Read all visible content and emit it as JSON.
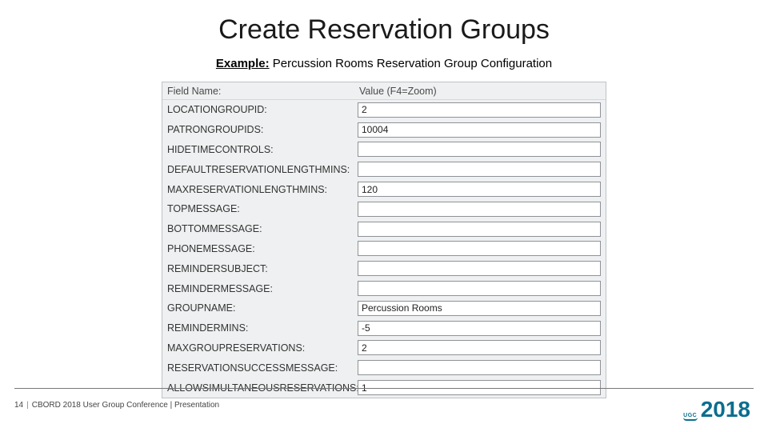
{
  "title": "Create Reservation Groups",
  "subtitle_prefix": "Example:",
  "subtitle_rest": " Percussion Rooms Reservation Group Configuration",
  "form": {
    "header_label": "Field Name:",
    "header_value": "Value (F4=Zoom)",
    "rows": [
      {
        "name": "LOCATIONGROUPID:",
        "value": "2"
      },
      {
        "name": "PATRONGROUPIDS:",
        "value": "10004"
      },
      {
        "name": "HIDETIMECONTROLS:",
        "value": ""
      },
      {
        "name": "DEFAULTRESERVATIONLENGTHMINS:",
        "value": ""
      },
      {
        "name": "MAXRESERVATIONLENGTHMINS:",
        "value": "120"
      },
      {
        "name": "TOPMESSAGE:",
        "value": ""
      },
      {
        "name": "BOTTOMMESSAGE:",
        "value": ""
      },
      {
        "name": "PHONEMESSAGE:",
        "value": ""
      },
      {
        "name": "REMINDERSUBJECT:",
        "value": ""
      },
      {
        "name": "REMINDERMESSAGE:",
        "value": ""
      },
      {
        "name": "GROUPNAME:",
        "value": "Percussion Rooms"
      },
      {
        "name": "REMINDERMINS:",
        "value": "-5"
      },
      {
        "name": "MAXGROUPRESERVATIONS:",
        "value": "2"
      },
      {
        "name": "RESERVATIONSUCCESSMESSAGE:",
        "value": ""
      },
      {
        "name": "ALLOWSIMULTANEOUSRESERVATIONS:",
        "value": "1"
      }
    ]
  },
  "footer": {
    "page": "14",
    "text": "CBORD 2018 User Group Conference | Presentation"
  },
  "logo": {
    "ugc": "UGC",
    "year": "2018"
  }
}
